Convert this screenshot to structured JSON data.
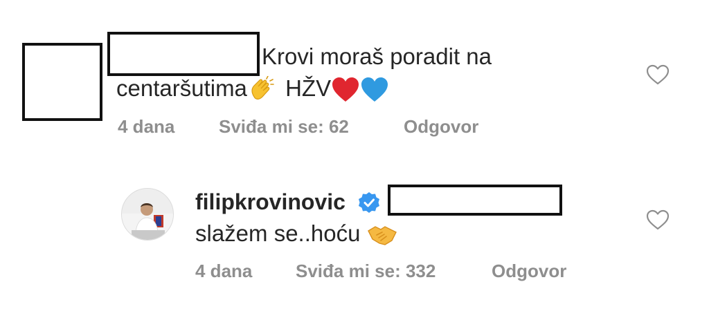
{
  "comments": [
    {
      "text_line1": "Krovi moraš poradit na",
      "text_line2": "centaršutima",
      "text_line2_suffix": "HŽV",
      "time": "4 dana",
      "likes": "Sviđa mi se: 62",
      "reply": "Odgovor"
    },
    {
      "username": "filipkrovinovic",
      "text": "slažem se..hoću",
      "time": "4 dana",
      "likes": "Sviđa mi se: 332",
      "reply": "Odgovor"
    }
  ],
  "icons": {
    "like": "heart-outline-icon",
    "verified": "verified-badge-icon",
    "clap": "clapping-hands-emoji",
    "red_heart": "red-heart-emoji",
    "blue_heart": "blue-heart-emoji",
    "handshake": "handshake-emoji"
  },
  "colors": {
    "text": "#262626",
    "meta": "#8e8e8e",
    "verified": "#3897f0",
    "heart_red": "#e0262f",
    "heart_blue": "#2f9ae0"
  }
}
